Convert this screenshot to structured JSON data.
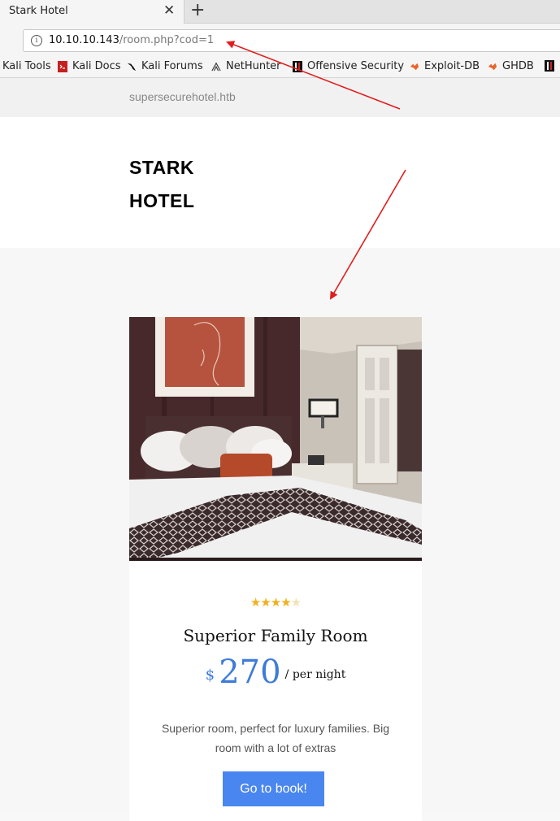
{
  "browser": {
    "tab_title": "Stark Hotel",
    "close_glyph": "✕",
    "new_tab_glyph": "+",
    "url_host": "10.10.10.143",
    "url_path": "/room.php?cod=1",
    "bookmarks": [
      {
        "label": "Kali Tools",
        "icon": "kali-icon"
      },
      {
        "label": "Kali Docs",
        "icon": "kali-docs-icon"
      },
      {
        "label": "Kali Forums",
        "icon": "kali-dragon-icon"
      },
      {
        "label": "NetHunter",
        "icon": "nethunter-icon"
      },
      {
        "label": "Offensive Security",
        "icon": "offsec-icon"
      },
      {
        "label": "Exploit-DB",
        "icon": "exploitdb-icon"
      },
      {
        "label": "GHDB",
        "icon": "ghdb-icon"
      }
    ]
  },
  "site": {
    "domain": "supersecurehotel.htb",
    "brand_line1": "STARK",
    "brand_line2": "HOTEL"
  },
  "room": {
    "rating": 4,
    "rating_max": 5,
    "title": "Superior Family Room",
    "currency": "$",
    "price": "270",
    "per_night": "/ per night",
    "description": "Superior room, perfect for luxury families. Big room with a lot of extras",
    "book_label": "Go to book!"
  },
  "colors": {
    "accent": "#4a86f0",
    "price": "#3f7bd8",
    "star": "#f2b01e",
    "annotation_arrow": "#e11d1d"
  }
}
